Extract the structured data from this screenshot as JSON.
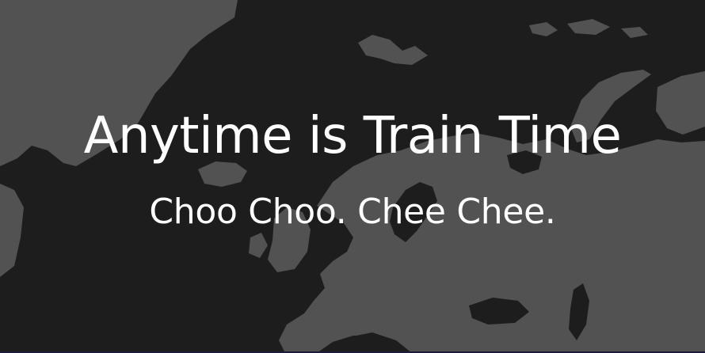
{
  "hero": {
    "headline": "Anytime is Train Time",
    "subheadline": "Choo Choo. Chee Chee.",
    "background_image": "europe-map-silhouette",
    "colors": {
      "background": "#1e1d1e",
      "land": "#535253",
      "text": "#ffffff"
    }
  }
}
